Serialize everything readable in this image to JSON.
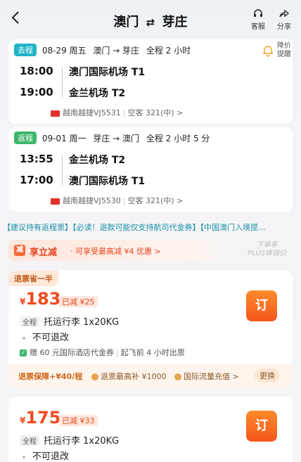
{
  "header": {
    "origin": "澳门",
    "destination": "芽庄",
    "service_label": "客服",
    "share_label": "分享"
  },
  "price_alert": {
    "label_line1": "降价",
    "label_line2": "提醒"
  },
  "outbound": {
    "tag": "去程",
    "date": "08-29 周五",
    "route": "澳门 → 芽庄",
    "duration": "全程 2 小时",
    "dep_time": "18:00",
    "dep_airport": "澳门国际机场 T1",
    "arr_time": "19:00",
    "arr_airport": "金兰机场 T2",
    "airline": "越南越捷VJ5531",
    "aircraft": "空客 321(中)"
  },
  "return": {
    "tag": "返程",
    "date": "09-01 周一",
    "route": "芽庄 → 澳门",
    "duration": "全程 2 小时 5 分",
    "dep_time": "13:55",
    "dep_airport": "金兰机场 T2",
    "arr_time": "17:00",
    "arr_airport": "澳门国际机场 T1",
    "airline": "越南越捷VJ5530",
    "aircraft": "空客 321(中)"
  },
  "notice": "【建议持有返程票】【必读！退款可能仅支持航司代金券】【中国澳门入境提...",
  "promo": {
    "title": "享立减",
    "subtitle": "· 可享受最高减 ¥4 优惠 >",
    "plus_line1": "下单享",
    "plus_line2": "PLUS体验价"
  },
  "offers": [
    {
      "ribbon": "退票省一半",
      "currency": "¥",
      "price": "183",
      "reduce": "已减 ¥25",
      "book": "订",
      "fare_tag": "全程",
      "baggage": "托运行李 1x20KG",
      "refund": "不可退改",
      "gift": "赠 60 元国际酒店代金券",
      "gift_note": "起飞前 4 小时出票",
      "guard_title": "退票保障+¥40/程",
      "guard_items": [
        "退票最高补 ¥1000",
        "国际流量充值 >"
      ],
      "change": "更换"
    },
    {
      "currency": "¥",
      "price": "175",
      "reduce": "已减 ¥33",
      "book": "订",
      "fare_tag": "全程",
      "baggage": "托运行李 1x20KG",
      "refund": "不可退改"
    }
  ]
}
